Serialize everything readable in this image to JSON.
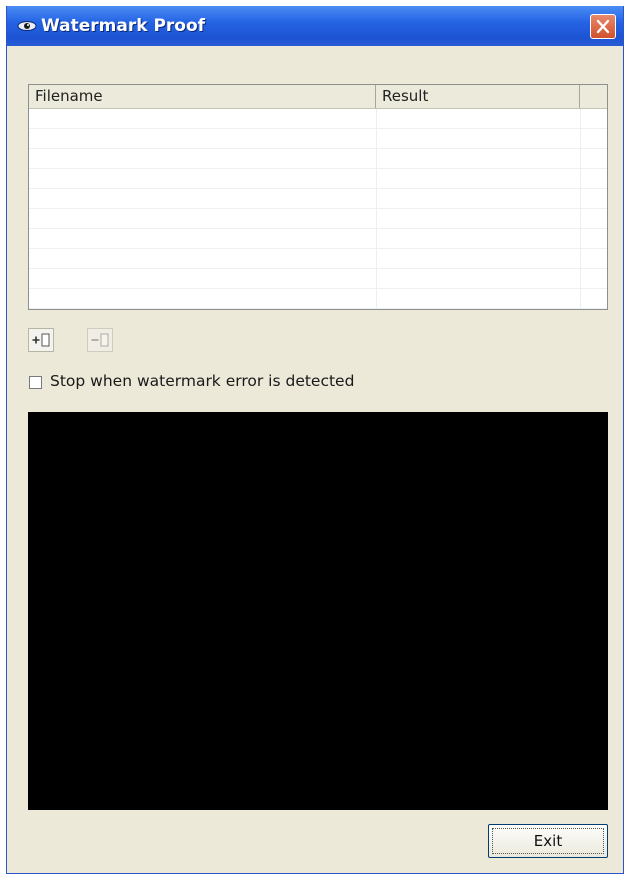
{
  "window": {
    "title": "Watermark Proof",
    "icon": "eye-icon",
    "close_icon": "close-icon"
  },
  "file_list": {
    "columns": [
      "Filename",
      "Result",
      ""
    ],
    "rows": []
  },
  "toolbar": {
    "add_icon": "add-file-icon",
    "remove_icon": "remove-file-icon",
    "remove_enabled": false
  },
  "options": {
    "stop_on_error_label": "Stop when watermark error is detected",
    "stop_on_error_checked": false
  },
  "log": {
    "background": "#000000"
  },
  "actions": {
    "exit_label": "Exit"
  },
  "colors": {
    "titlebar": "#2564e5",
    "dialog_bg": "#ece9d8",
    "close_button": "#d2502c"
  }
}
